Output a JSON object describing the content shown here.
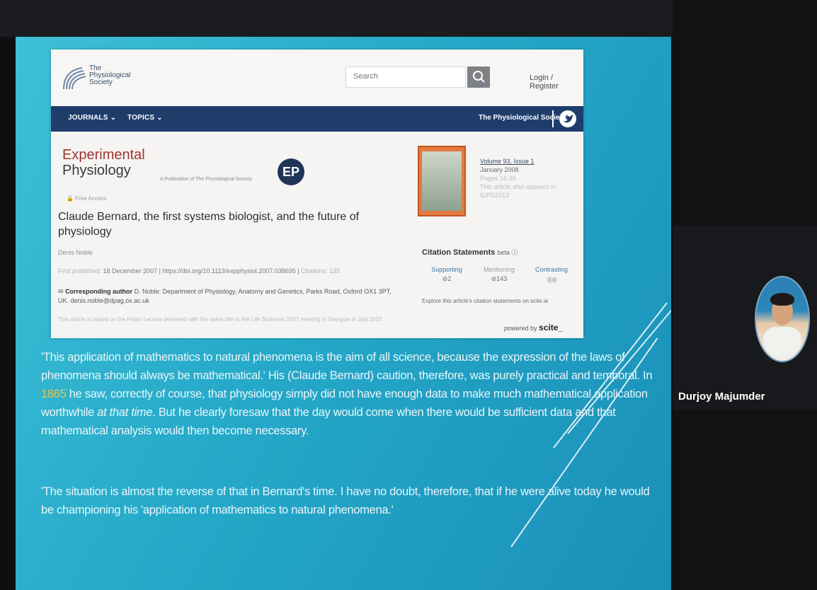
{
  "participant": {
    "name": "Durjoy Majumder"
  },
  "webpage": {
    "logo_lines": [
      "The",
      "Physiological",
      "Society"
    ],
    "search_placeholder": "Search",
    "login": "Login / Register",
    "nav": [
      "JOURNALS ⌄",
      "TOPICS ⌄"
    ],
    "nav_society": "The Physiological Society",
    "journal_line1": "Experimental",
    "journal_line2": "Physiology",
    "journal_sub": "A Publication of The Physiological Society",
    "ep_badge": "EP",
    "free_access": "🔓 Free Access",
    "article_title": "Claude Bernard, the first systems biologist, and the future of physiology",
    "author": "Denis Noble",
    "first_published_label": "First published:",
    "first_published": "18 December 2007",
    "doi": "https://doi.org/10.1113/expphysiol.2007.038695",
    "citations": "Citations: 135",
    "corresponding_label": "Corresponding author",
    "corresponding_text": "D. Noble: Department of Physiology, Anatomy and Genetics, Parks Road, Oxford OX1 3PT, UK.",
    "email": "denis.noble@dpag.ox.ac.uk",
    "note": "This article is based on the Paton Lecture delivered with the same title to the Life Sciences 2007 meeting in Glasgow in July 2007.",
    "volume": "Volume 93, Issue 1",
    "date": "January 2008",
    "pages": "Pages 16-26",
    "also_appears": "This article also appears in:",
    "also_appears_in": "IUPS2013",
    "citation_statements": "Citation Statements",
    "beta": "beta ⓘ",
    "supporting_label": "Supporting",
    "supporting_count": "⊘2",
    "mentioning_label": "Mentioning",
    "mentioning_count": "⊘143",
    "contrasting_label": "Contrasting",
    "contrasting_count": "⓪0",
    "explore": "Explore this article's citation statements on scite.ai",
    "powered_by": "powered by",
    "scite": "scite_"
  },
  "slide": {
    "para1_a": "'This application of mathematics to natural phenomena is the aim of all science, because the expression of the laws of phenomena should always be mathematical.' His (Claude Bernard) caution, therefore, was purely practical and temporal. In ",
    "para1_year": "1865",
    "para1_b": " he saw, correctly of course, that physiology simply did not have enough data to make much mathematical application worthwhile ",
    "para1_italic": "at that time",
    "para1_c": ". But he clearly foresaw that the day would come when there would be sufficient data and that mathematical analysis would then become necessary.",
    "para2": "'The situation is almost the reverse of that in Bernard's time. I have no doubt, therefore, that if he were alive today he would be championing his 'application of mathematics to natural phenomena.'"
  },
  "colors": {
    "slide_bg": "#25a9c9",
    "nav_bg": "#1f3d6b",
    "journal_red": "#a2342f",
    "year_highlight": "#e0c65a"
  }
}
